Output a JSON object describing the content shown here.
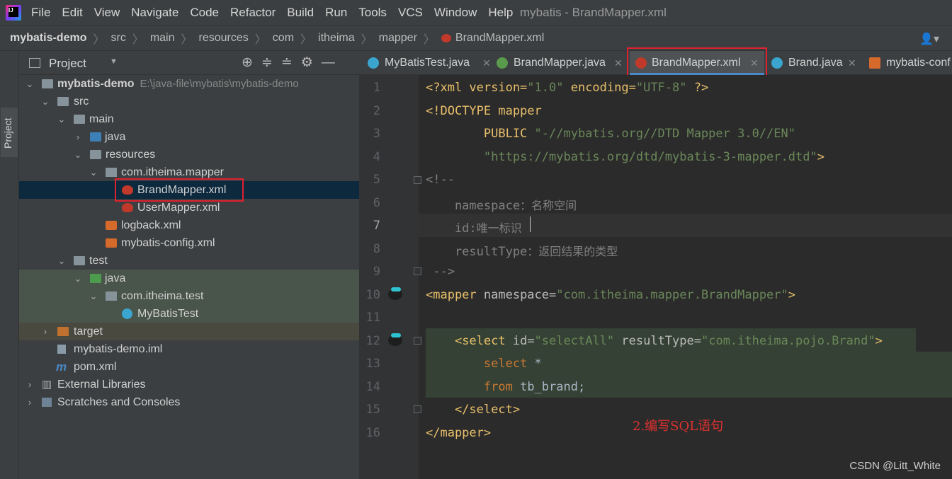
{
  "app": {
    "menu": [
      "File",
      "Edit",
      "View",
      "Navigate",
      "Code",
      "Refactor",
      "Build",
      "Run",
      "Tools",
      "VCS",
      "Window",
      "Help"
    ],
    "window_title": "mybatis - BrandMapper.xml"
  },
  "breadcrumb": [
    "mybatis-demo",
    "src",
    "main",
    "resources",
    "com",
    "itheima",
    "mapper",
    "BrandMapper.xml"
  ],
  "stripe": {
    "project_label": "Project"
  },
  "project_panel": {
    "title": "Project",
    "tree": [
      {
        "label": "mybatis-demo",
        "sub": "E:\\java-file\\mybatis\\mybatis-demo"
      },
      {
        "label": "src"
      },
      {
        "label": "main"
      },
      {
        "label": "java"
      },
      {
        "label": "resources"
      },
      {
        "label": "com.itheima.mapper"
      },
      {
        "label": "BrandMapper.xml"
      },
      {
        "label": "UserMapper.xml"
      },
      {
        "label": "logback.xml"
      },
      {
        "label": "mybatis-config.xml"
      },
      {
        "label": "test"
      },
      {
        "label": "java"
      },
      {
        "label": "com.itheima.test"
      },
      {
        "label": "MyBatisTest"
      },
      {
        "label": "target"
      },
      {
        "label": "mybatis-demo.iml"
      },
      {
        "label": "pom.xml"
      },
      {
        "label": "External Libraries"
      },
      {
        "label": "Scratches and Consoles"
      }
    ]
  },
  "tabs": [
    "MyBatisTest.java",
    "BrandMapper.java",
    "BrandMapper.xml",
    "Brand.java",
    "mybatis-conf"
  ],
  "line_numbers": [
    "1",
    "2",
    "3",
    "4",
    "5",
    "6",
    "7",
    "8",
    "9",
    "10",
    "11",
    "12",
    "13",
    "14",
    "15",
    "16"
  ],
  "code": {
    "l1": [
      "<?xml version=",
      "\"1.0\"",
      " encoding=",
      "\"UTF-8\"",
      " ?>"
    ],
    "l2": [
      "<!DOCTYPE mapper"
    ],
    "l3": [
      "        PUBLIC ",
      "\"-//mybatis.org//DTD Mapper 3.0//EN\""
    ],
    "l4": [
      "        ",
      "\"https://mybatis.org/dtd/mybatis-3-mapper.dtd\"",
      ">"
    ],
    "l5": "<!--",
    "l6": [
      "    namespace",
      "：名称空间"
    ],
    "l7": [
      "    id:",
      "唯一标识"
    ],
    "l8": [
      "    resultType",
      "：返回结果的类型"
    ],
    "l9": " -->",
    "l10": [
      "<mapper",
      " namespace=",
      "\"com.itheima.mapper.BrandMapper\"",
      ">"
    ],
    "l12": [
      "    ",
      "<select",
      " id=",
      "\"selectAll\"",
      " resultType=",
      "\"com.itheima.pojo.Brand\"",
      ">"
    ],
    "l13": [
      "        ",
      "select",
      " *"
    ],
    "l14": [
      "        ",
      "from",
      " tb_brand;"
    ],
    "l15": [
      "    ",
      "</select>"
    ],
    "l16": [
      "</mapper>"
    ]
  },
  "annotation": "2.编写SQL语句",
  "watermark": "CSDN @Litt_White"
}
